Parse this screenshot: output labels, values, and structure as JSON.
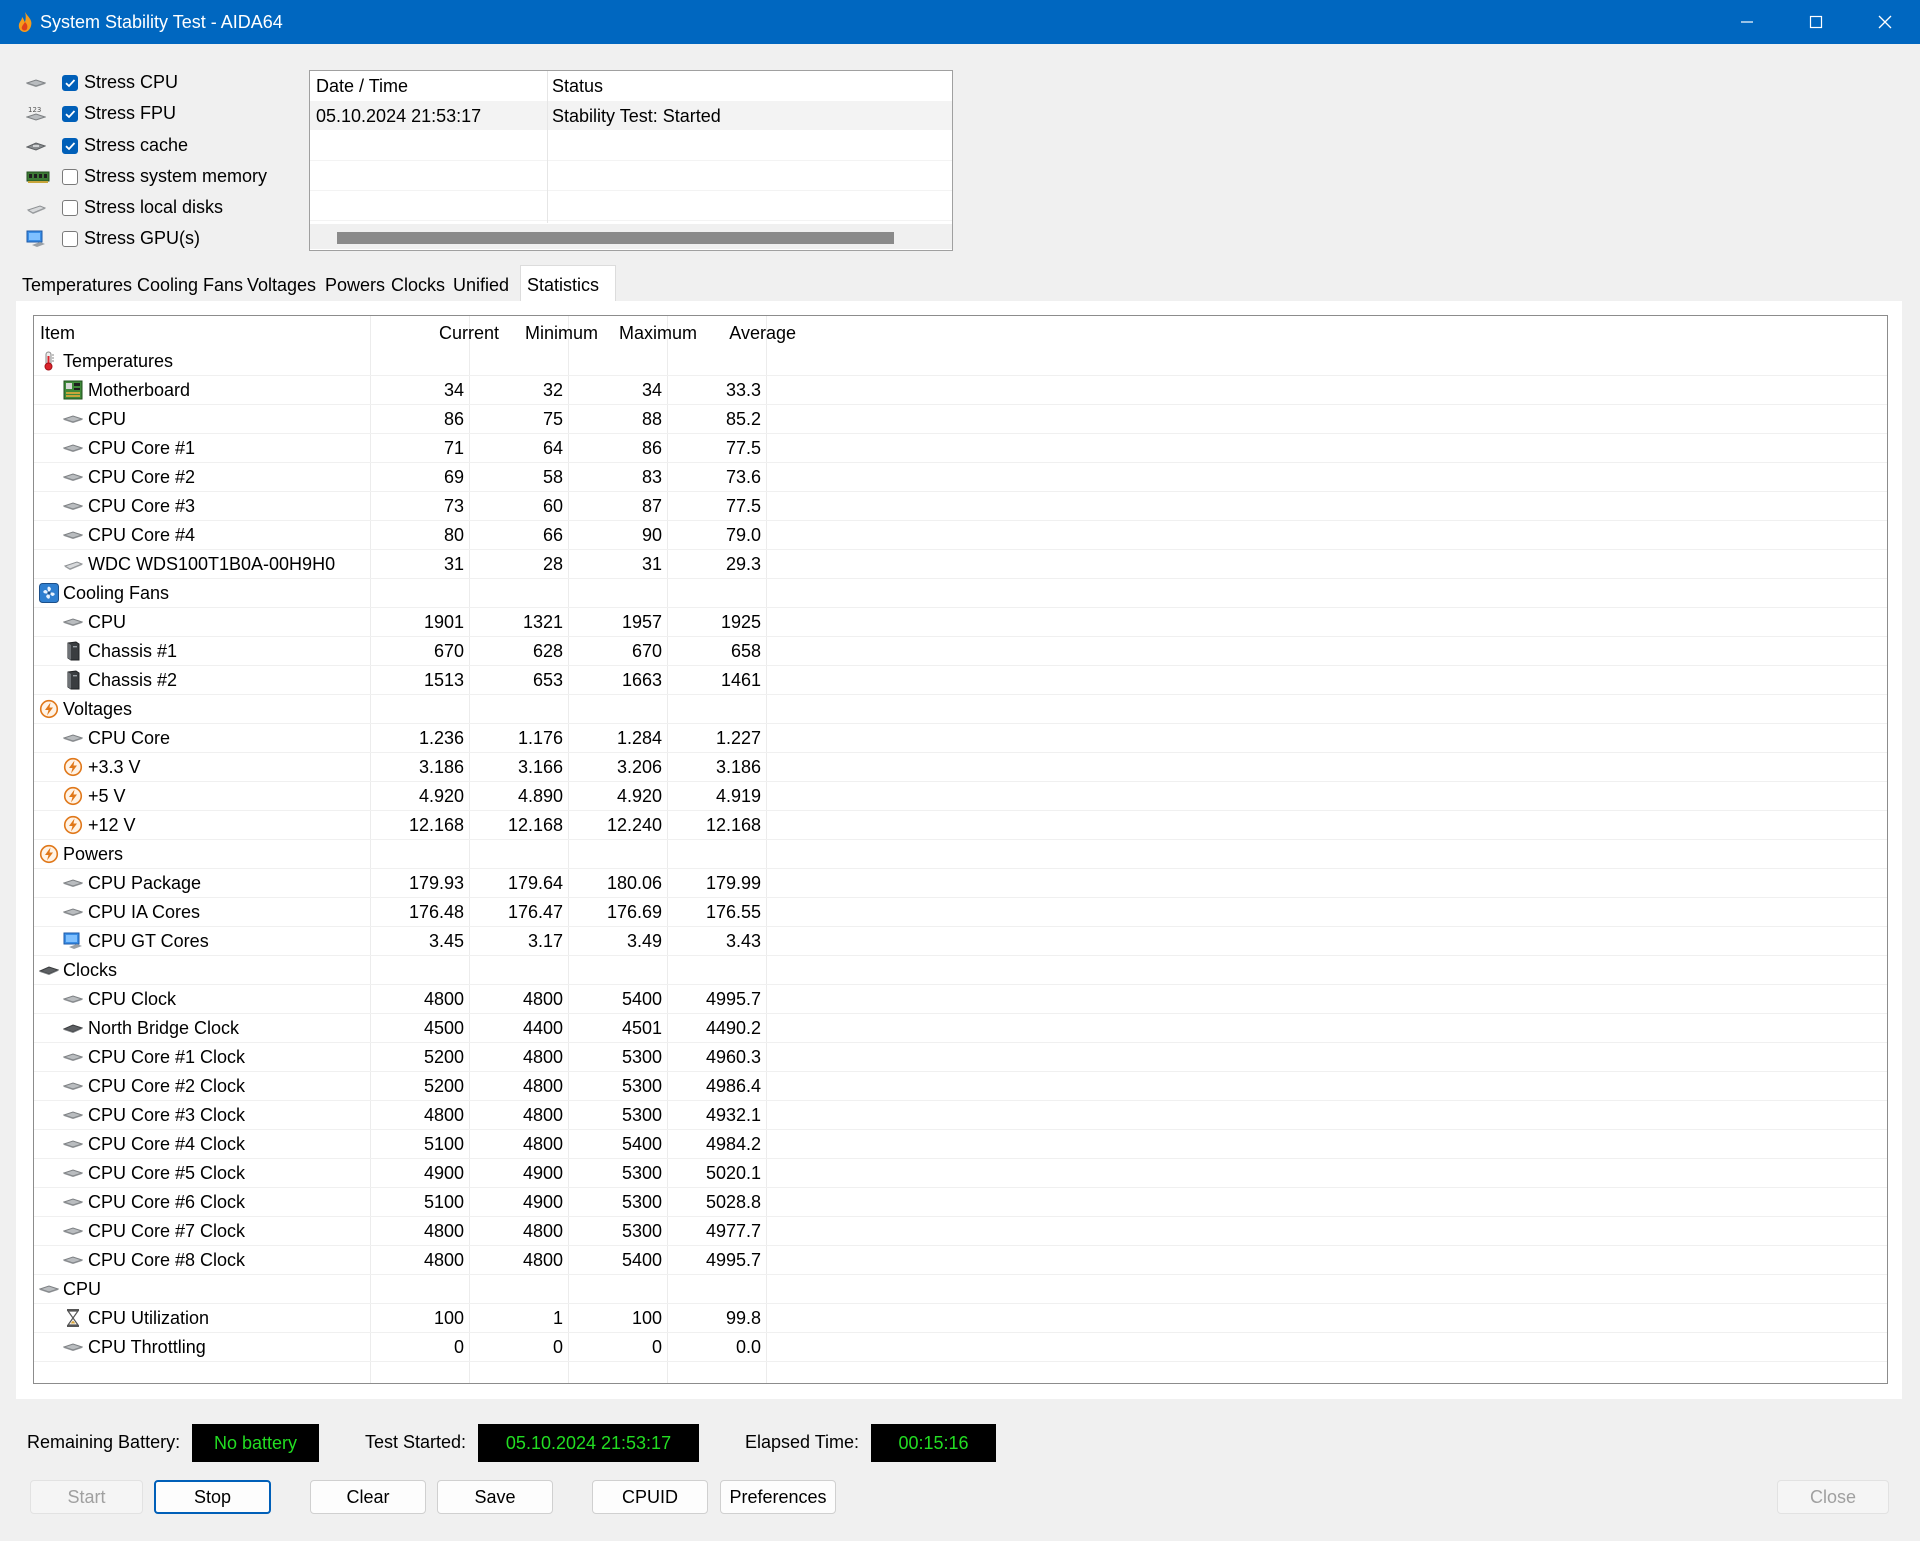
{
  "window": {
    "title": "System Stability Test - AIDA64"
  },
  "stress_options": [
    {
      "label": "Stress CPU",
      "checked": true,
      "icon": "cpu-chip-icon"
    },
    {
      "label": "Stress FPU",
      "checked": true,
      "icon": "fpu-icon"
    },
    {
      "label": "Stress cache",
      "checked": true,
      "icon": "cache-icon"
    },
    {
      "label": "Stress system memory",
      "checked": false,
      "icon": "memory-icon"
    },
    {
      "label": "Stress local disks",
      "checked": false,
      "icon": "disk-icon"
    },
    {
      "label": "Stress GPU(s)",
      "checked": false,
      "icon": "gpu-icon"
    }
  ],
  "log": {
    "headers": {
      "datetime": "Date / Time",
      "status": "Status"
    },
    "rows": [
      {
        "datetime": "05.10.2024 21:53:17",
        "status": "Stability Test: Started"
      }
    ]
  },
  "tabs": [
    "Temperatures",
    "Cooling Fans",
    "Voltages",
    "Powers",
    "Clocks",
    "Unified",
    "Statistics"
  ],
  "active_tab": "Statistics",
  "stats": {
    "headers": {
      "item": "Item",
      "current": "Current",
      "minimum": "Minimum",
      "maximum": "Maximum",
      "average": "Average"
    },
    "rows": [
      {
        "type": "group",
        "name": "Temperatures",
        "icon": "thermometer-icon"
      },
      {
        "name": "Motherboard",
        "icon": "motherboard-icon",
        "cur": "34",
        "min": "32",
        "max": "34",
        "avg": "33.3"
      },
      {
        "name": "CPU",
        "icon": "cpu-chip-icon",
        "cur": "86",
        "min": "75",
        "max": "88",
        "avg": "85.2"
      },
      {
        "name": "CPU Core #1",
        "icon": "cpu-chip-icon",
        "cur": "71",
        "min": "64",
        "max": "86",
        "avg": "77.5"
      },
      {
        "name": "CPU Core #2",
        "icon": "cpu-chip-icon",
        "cur": "69",
        "min": "58",
        "max": "83",
        "avg": "73.6"
      },
      {
        "name": "CPU Core #3",
        "icon": "cpu-chip-icon",
        "cur": "73",
        "min": "60",
        "max": "87",
        "avg": "77.5"
      },
      {
        "name": "CPU Core #4",
        "icon": "cpu-chip-icon",
        "cur": "80",
        "min": "66",
        "max": "90",
        "avg": "79.0"
      },
      {
        "name": "WDC WDS100T1B0A-00H9H0",
        "icon": "disk-icon",
        "cur": "31",
        "min": "28",
        "max": "31",
        "avg": "29.3"
      },
      {
        "type": "group",
        "name": "Cooling Fans",
        "icon": "fan-icon"
      },
      {
        "name": "CPU",
        "icon": "cpu-chip-icon",
        "cur": "1901",
        "min": "1321",
        "max": "1957",
        "avg": "1925"
      },
      {
        "name": "Chassis #1",
        "icon": "chassis-icon",
        "cur": "670",
        "min": "628",
        "max": "670",
        "avg": "658"
      },
      {
        "name": "Chassis #2",
        "icon": "chassis-icon",
        "cur": "1513",
        "min": "653",
        "max": "1663",
        "avg": "1461"
      },
      {
        "type": "group",
        "name": "Voltages",
        "icon": "lightning-icon"
      },
      {
        "name": "CPU Core",
        "icon": "cpu-chip-icon",
        "cur": "1.236",
        "min": "1.176",
        "max": "1.284",
        "avg": "1.227"
      },
      {
        "name": "+3.3 V",
        "icon": "lightning-icon",
        "cur": "3.186",
        "min": "3.166",
        "max": "3.206",
        "avg": "3.186"
      },
      {
        "name": "+5 V",
        "icon": "lightning-icon",
        "cur": "4.920",
        "min": "4.890",
        "max": "4.920",
        "avg": "4.919"
      },
      {
        "name": "+12 V",
        "icon": "lightning-icon",
        "cur": "12.168",
        "min": "12.168",
        "max": "12.240",
        "avg": "12.168"
      },
      {
        "type": "group",
        "name": "Powers",
        "icon": "lightning-icon"
      },
      {
        "name": "CPU Package",
        "icon": "cpu-chip-icon",
        "cur": "179.93",
        "min": "179.64",
        "max": "180.06",
        "avg": "179.99"
      },
      {
        "name": "CPU IA Cores",
        "icon": "cpu-chip-icon",
        "cur": "176.48",
        "min": "176.47",
        "max": "176.69",
        "avg": "176.55"
      },
      {
        "name": "CPU GT Cores",
        "icon": "gpu-icon",
        "cur": "3.45",
        "min": "3.17",
        "max": "3.49",
        "avg": "3.43"
      },
      {
        "type": "group",
        "name": "Clocks",
        "icon": "clock-chip-icon"
      },
      {
        "name": "CPU Clock",
        "icon": "cpu-chip-icon",
        "cur": "4800",
        "min": "4800",
        "max": "5400",
        "avg": "4995.7"
      },
      {
        "name": "North Bridge Clock",
        "icon": "clock-chip-icon",
        "cur": "4500",
        "min": "4400",
        "max": "4501",
        "avg": "4490.2"
      },
      {
        "name": "CPU Core #1 Clock",
        "icon": "cpu-chip-icon",
        "cur": "5200",
        "min": "4800",
        "max": "5300",
        "avg": "4960.3"
      },
      {
        "name": "CPU Core #2 Clock",
        "icon": "cpu-chip-icon",
        "cur": "5200",
        "min": "4800",
        "max": "5300",
        "avg": "4986.4"
      },
      {
        "name": "CPU Core #3 Clock",
        "icon": "cpu-chip-icon",
        "cur": "4800",
        "min": "4800",
        "max": "5300",
        "avg": "4932.1"
      },
      {
        "name": "CPU Core #4 Clock",
        "icon": "cpu-chip-icon",
        "cur": "5100",
        "min": "4800",
        "max": "5400",
        "avg": "4984.2"
      },
      {
        "name": "CPU Core #5 Clock",
        "icon": "cpu-chip-icon",
        "cur": "4900",
        "min": "4900",
        "max": "5300",
        "avg": "5020.1"
      },
      {
        "name": "CPU Core #6 Clock",
        "icon": "cpu-chip-icon",
        "cur": "5100",
        "min": "4900",
        "max": "5300",
        "avg": "5028.8"
      },
      {
        "name": "CPU Core #7 Clock",
        "icon": "cpu-chip-icon",
        "cur": "4800",
        "min": "4800",
        "max": "5300",
        "avg": "4977.7"
      },
      {
        "name": "CPU Core #8 Clock",
        "icon": "cpu-chip-icon",
        "cur": "4800",
        "min": "4800",
        "max": "5400",
        "avg": "4995.7"
      },
      {
        "type": "group",
        "name": "CPU",
        "icon": "cpu-chip-icon"
      },
      {
        "name": "CPU Utilization",
        "icon": "hourglass-icon",
        "cur": "100",
        "min": "1",
        "max": "100",
        "avg": "99.8"
      },
      {
        "name": "CPU Throttling",
        "icon": "cpu-chip-icon",
        "cur": "0",
        "min": "0",
        "max": "0",
        "avg": "0.0"
      }
    ]
  },
  "status_bar": {
    "battery_label": "Remaining Battery:",
    "battery_value": "No battery",
    "started_label": "Test Started:",
    "started_value": "05.10.2024 21:53:17",
    "elapsed_label": "Elapsed Time:",
    "elapsed_value": "00:15:16"
  },
  "buttons": {
    "start": "Start",
    "stop": "Stop",
    "clear": "Clear",
    "save": "Save",
    "cpuid": "CPUID",
    "preferences": "Preferences",
    "close": "Close"
  },
  "colors": {
    "title_bar": "#0067c0",
    "accent": "#005fb8",
    "readout_text": "#22dd22"
  }
}
